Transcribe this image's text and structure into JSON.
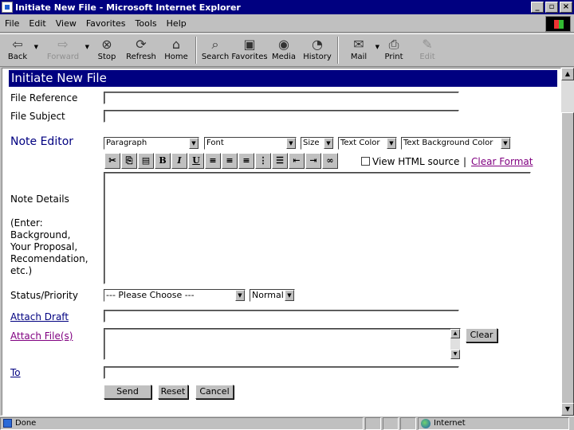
{
  "window": {
    "title": "Initiate New File - Microsoft Internet Explorer",
    "min": "_",
    "max": "▫",
    "close": "×"
  },
  "menu": [
    "File",
    "Edit",
    "View",
    "Favorites",
    "Tools",
    "Help"
  ],
  "toolbar": {
    "back": "Back",
    "forward": "Forward",
    "stop": "Stop",
    "refresh": "Refresh",
    "home": "Home",
    "search": "Search",
    "favorites": "Favorites",
    "media": "Media",
    "history": "History",
    "mail": "Mail",
    "print": "Print",
    "edit": "Edit"
  },
  "page": {
    "header": "Initiate New File",
    "file_reference_label": "File Reference",
    "file_subject_label": "File Subject",
    "note_editor_label": "Note Editor",
    "note_details_label": "Note Details",
    "note_details_hint": [
      "(Enter:",
      "Background,",
      "Your Proposal,",
      "Recomendation,",
      "etc.)"
    ],
    "status_priority_label": "Status/Priority",
    "attach_draft_label": "Attach Draft",
    "attach_files_label": "Attach File(s)",
    "to_label": "To",
    "editor": {
      "paragraph": "Paragraph",
      "font": "Font",
      "size": "Size",
      "text_color": "Text Color",
      "text_bg_color": "Text Background Color",
      "view_html_label": "View HTML source",
      "separator": "|",
      "clear_format": "Clear Format"
    },
    "status_select": "--- Please Choose ---",
    "priority_select": "Normal",
    "clear_button": "Clear",
    "send_button": "Send",
    "reset_button": "Reset",
    "cancel_button": "Cancel"
  },
  "status": {
    "text": "Done",
    "zone": "Internet"
  }
}
